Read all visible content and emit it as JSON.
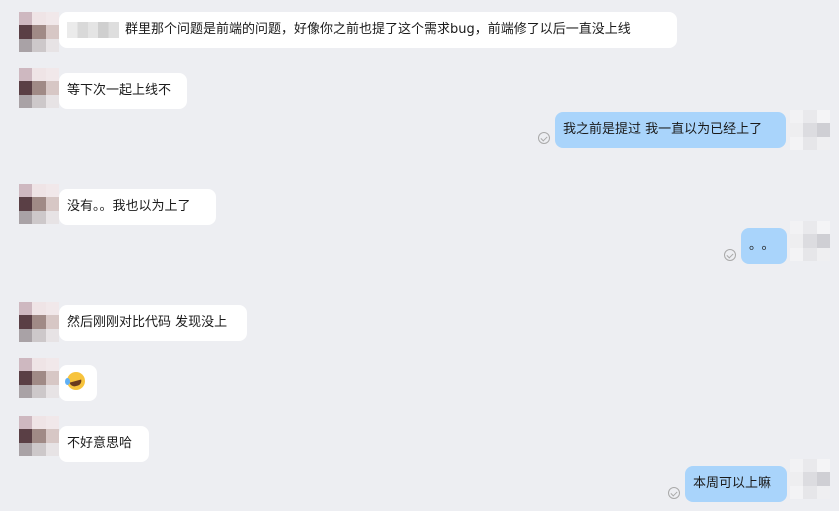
{
  "colors": {
    "background": "#edeef2",
    "incoming_bubble": "#ffffff",
    "outgoing_bubble": "#a9d4fb",
    "read_receipt": "#a9a9a9"
  },
  "messages": [
    {
      "side": "incoming",
      "text": "群里那个问题是前端的问题，好像你之前也提了这个需求bug，前端修了以后一直没上线",
      "has_name_tag": true
    },
    {
      "side": "incoming",
      "text": "等下次一起上线不"
    },
    {
      "side": "outgoing",
      "text": "我之前是提过 我一直以为已经上了",
      "read": true
    },
    {
      "side": "incoming",
      "text": "没有。。我也以为上了"
    },
    {
      "side": "outgoing",
      "text": "。。",
      "read": true
    },
    {
      "side": "incoming",
      "text": "然后刚刚对比代码 发现没上"
    },
    {
      "side": "incoming",
      "emoji": "rolling-on-floor-laughing-emoji"
    },
    {
      "side": "incoming",
      "text": "不好意思哈"
    },
    {
      "side": "outgoing",
      "text": "本周可以上嘛",
      "read": true
    }
  ]
}
